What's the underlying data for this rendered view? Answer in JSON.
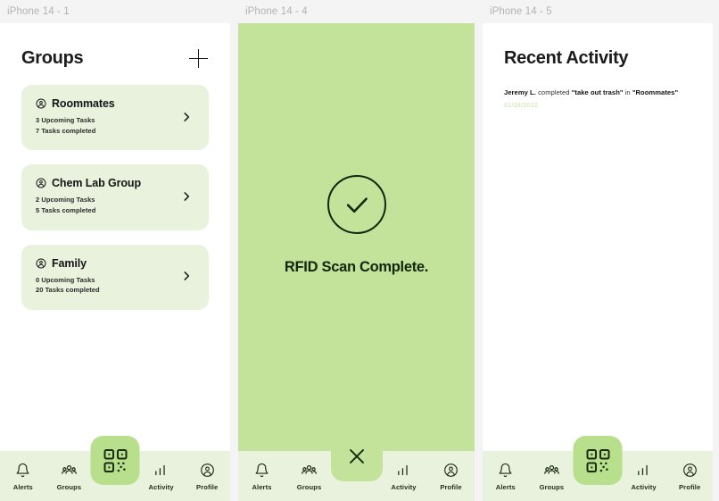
{
  "frames": [
    {
      "label": "iPhone 14 - 1",
      "screen": "groups"
    },
    {
      "label": "iPhone 14 - 4",
      "screen": "scan"
    },
    {
      "label": "iPhone 14 - 5",
      "screen": "activity"
    }
  ],
  "groups_screen": {
    "title": "Groups",
    "add_label": "+",
    "cards": [
      {
        "name": "Roommates",
        "upcoming": "3 Upcoming Tasks",
        "completed": "7 Tasks completed"
      },
      {
        "name": "Chem Lab Group",
        "upcoming": "2 Upcoming Tasks",
        "completed": "5 Tasks completed"
      },
      {
        "name": "Family",
        "upcoming": "0 Upcoming Tasks",
        "completed": "20 Tasks completed"
      }
    ]
  },
  "scan_screen": {
    "status_text": "RFID Scan Complete.",
    "icon": "check-circle-icon",
    "background_color": "#c3e39a"
  },
  "activity_screen": {
    "title": "Recent Activity",
    "items": [
      {
        "actor": "Jeremy L.",
        "verb": " completed ",
        "task": "\"take out trash\"",
        "preposition": " in ",
        "group": "\"Roommates\"",
        "date": "01/28/2022"
      }
    ]
  },
  "tabbar": {
    "tabs": [
      {
        "label": "Alerts",
        "icon": "bell-icon"
      },
      {
        "label": "Groups",
        "icon": "people-icon"
      },
      {
        "label": "Activity",
        "icon": "bar-chart-icon"
      },
      {
        "label": "Profile",
        "icon": "user-circle-icon"
      }
    ],
    "center_scan": {
      "icon": "qr-code-icon"
    },
    "center_close": {
      "icon": "close-icon"
    }
  },
  "colors": {
    "page_background": "#f4f4f4",
    "card_green": "#e9f2dd",
    "accent_green": "#b8e08c",
    "scan_green": "#c3e39a",
    "text_dark": "#141414",
    "date_green": "#dbe9c6"
  }
}
